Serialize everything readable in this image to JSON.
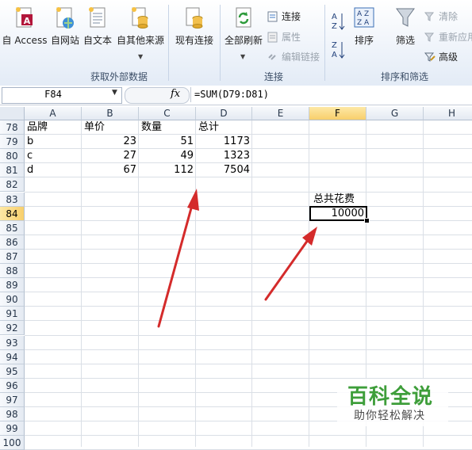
{
  "ribbon": {
    "get_external_data": {
      "label": "获取外部数据",
      "buttons": [
        "自 Access",
        "自网站",
        "自文本",
        "自其他来源"
      ]
    },
    "existing_connections_label": "现有连接",
    "connections": {
      "label": "连接",
      "refresh_all": "全部刷新",
      "connections_item": "连接",
      "properties_item": "属性",
      "edit_links_item": "编辑链接"
    },
    "sort_filter": {
      "label": "排序和筛选",
      "sort": "排序",
      "filter": "筛选",
      "clear": "清除",
      "reapply": "重新应用",
      "advanced": "高级"
    }
  },
  "formula_bar": {
    "name_box": "F84",
    "fx": "fx",
    "formula": "=SUM(D79:D81)"
  },
  "columns": [
    "A",
    "B",
    "C",
    "D",
    "E",
    "F",
    "G",
    "H"
  ],
  "selected_column": "F",
  "rows": [
    "78",
    "79",
    "80",
    "81",
    "82",
    "83",
    "84",
    "85",
    "86",
    "87",
    "88",
    "89",
    "90",
    "91",
    "92",
    "93",
    "94",
    "95",
    "96",
    "97",
    "98",
    "99",
    "100"
  ],
  "selected_row": "84",
  "cells": {
    "A78": "品牌",
    "B78": "单价",
    "C78": "数量",
    "D78": "总计",
    "A79": "b",
    "B79": "23",
    "C79": "51",
    "D79": "1173",
    "A80": "c",
    "B80": "27",
    "C80": "49",
    "D80": "1323",
    "A81": "d",
    "B81": "67",
    "C81": "112",
    "D81": "7504",
    "F83": "总共花费",
    "F84": "10000"
  },
  "annotation_color": "#d42b2b",
  "watermark": {
    "title": "百科全说",
    "subtitle": "助你轻松解决"
  }
}
